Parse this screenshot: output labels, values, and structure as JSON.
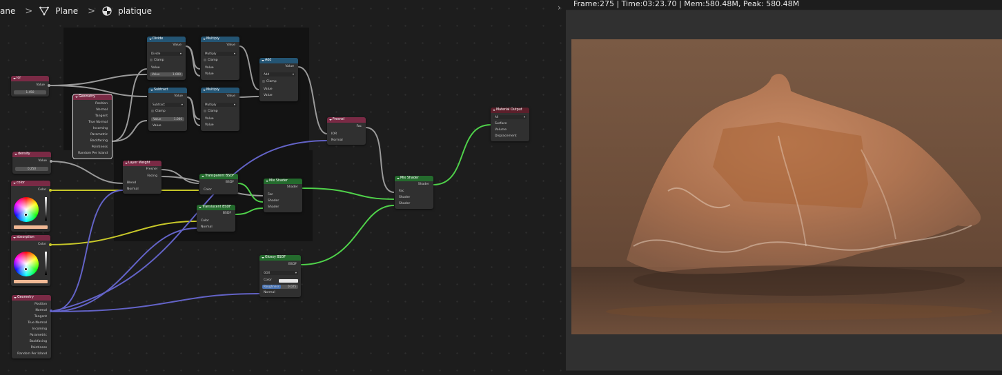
{
  "breadcrumb": {
    "items": [
      {
        "label": "ane",
        "icon": "object-icon"
      },
      {
        "label": "Plane",
        "icon": "mesh-icon"
      },
      {
        "label": "platique",
        "icon": "material-icon"
      }
    ]
  },
  "render": {
    "header": "Frame:275 | Time:03:23.70 | Mem:580.48M, Peak: 580.48M"
  },
  "colors": {
    "color_socket": "#c7c729",
    "float_socket": "#a1a1a1",
    "shader_socket": "#4fd14a",
    "vector_socket": "#6363c7"
  },
  "nodes": {
    "ior": {
      "title": "ior",
      "out": "Value",
      "value": "1.450"
    },
    "density": {
      "title": "density",
      "out": "Value",
      "value": "0.250"
    },
    "color": {
      "title": "color",
      "out": "Color",
      "swatch": "#f1b995"
    },
    "absorption": {
      "title": "absorption",
      "out": "Color",
      "swatch": "#f1b995"
    },
    "geom1": {
      "title": "Geometry",
      "outs": [
        "Position",
        "Normal",
        "Tangent",
        "True Normal",
        "Incoming",
        "Parametric",
        "Backfacing",
        "Pointiness",
        "Random Per Island"
      ]
    },
    "geom2": {
      "title": "Geometry",
      "outs": [
        "Position",
        "Normal",
        "Tangent",
        "True Normal",
        "Incoming",
        "Parametric",
        "Backfacing",
        "Pointiness",
        "Random Per Island"
      ]
    },
    "divide": {
      "title": "Divide",
      "out": "Value",
      "op": "Divide",
      "clamp": "Clamp",
      "in1": "Value",
      "in2": "Value",
      "in2val": "1.000"
    },
    "subtract": {
      "title": "Subtract",
      "out": "Value",
      "op": "Subtract",
      "clamp": "Clamp",
      "in1": "Value",
      "in2": "Value",
      "in2val": "1.000"
    },
    "multiply1": {
      "title": "Multiply",
      "out": "Value",
      "op": "Multiply",
      "clamp": "Clamp",
      "in1": "Value",
      "in2": "Value"
    },
    "multiply2": {
      "title": "Multiply",
      "out": "Value",
      "op": "Multiply",
      "clamp": "Clamp",
      "in1": "Value",
      "in2": "Value"
    },
    "add": {
      "title": "Add",
      "out": "Value",
      "op": "Add",
      "clamp": "Clamp",
      "in1": "Value",
      "in2": "Value"
    },
    "fresnel": {
      "title": "Fresnel",
      "out": "Fac",
      "in1": "IOR",
      "in2": "Normal"
    },
    "layer": {
      "title": "Layer Weight",
      "outs": [
        "Fresnel",
        "Facing"
      ],
      "ins": [
        "Blend",
        "Normal"
      ]
    },
    "trans1": {
      "title": "Transparent BSDF",
      "out": "BSDF",
      "in1": "Color"
    },
    "trans2": {
      "title": "Translucent BSDF",
      "out": "BSDF",
      "in1": "Color",
      "in2": "Normal"
    },
    "mix1": {
      "title": "Mix Shader",
      "out": "Shader",
      "ins": [
        "Fac",
        "Shader",
        "Shader"
      ]
    },
    "mix2": {
      "title": "Mix Shader",
      "out": "Shader",
      "ins": [
        "Fac",
        "Shader",
        "Shader"
      ]
    },
    "glossy": {
      "title": "Glossy BSDF",
      "out": "BSDF",
      "dist": "GGX",
      "in1": "Color",
      "rough_label": "Roughness",
      "rough_val": "0.025",
      "in3": "Normal",
      "swatch": "#e8e8e8"
    },
    "output": {
      "title": "Material Output",
      "target": "All",
      "ins": [
        "Surface",
        "Volume",
        "Displacement"
      ]
    }
  }
}
